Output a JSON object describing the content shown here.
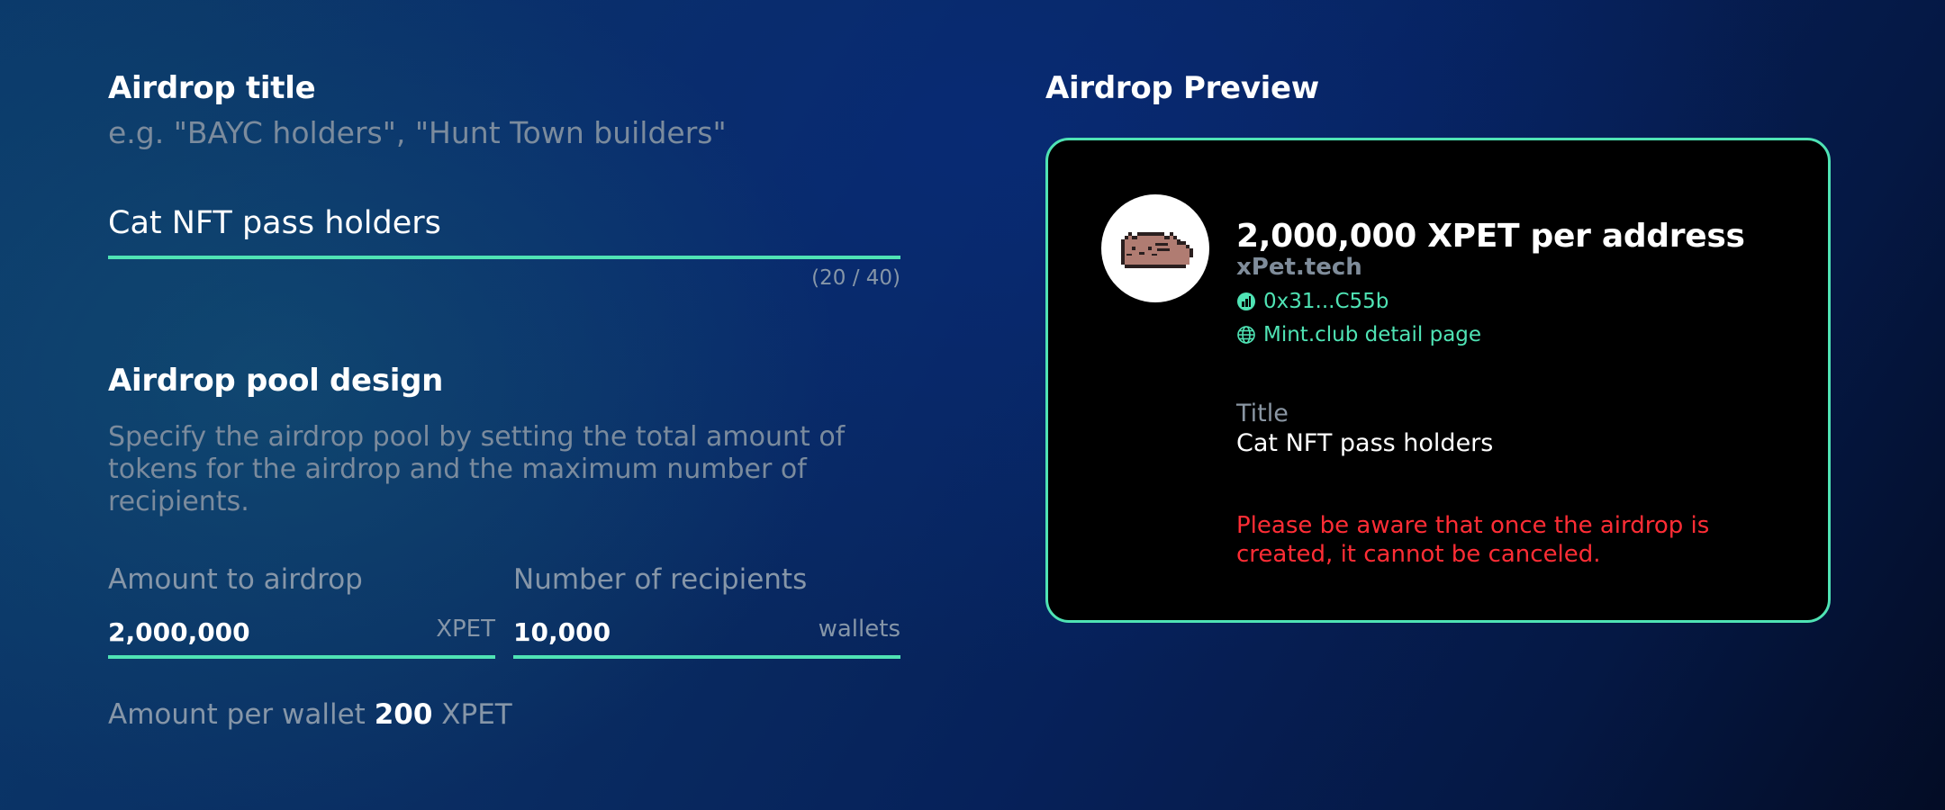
{
  "form": {
    "title_section": {
      "label": "Airdrop title",
      "hint": "e.g. \"BAYC holders\", \"Hunt Town builders\"",
      "value": "Cat NFT pass holders",
      "counter": "(20 / 40)"
    },
    "pool_section": {
      "label": "Airdrop pool design",
      "description": "Specify the airdrop pool by setting the total amount of tokens for the airdrop and the maximum number of recipients.",
      "amount": {
        "label": "Amount to airdrop",
        "value": "2,000,000",
        "unit": "XPET"
      },
      "recipients": {
        "label": "Number of recipients",
        "value": "10,000",
        "unit": "wallets"
      },
      "per_wallet": {
        "prefix": "Amount per wallet",
        "value": "200",
        "unit": "XPET"
      }
    }
  },
  "preview": {
    "label": "Airdrop Preview",
    "heading": "2,000,000 XPET per address",
    "issuer": "xPet.tech",
    "contract_link": "0x31...C55b",
    "contract_icon": "mint-club-logo-icon",
    "detail_link": "Mint.club detail page",
    "detail_icon": "globe-icon",
    "avatar_icon": "pixel-cat-icon",
    "meta_label": "Title",
    "meta_value": "Cat NFT pass holders",
    "warning": "Please be aware that once the airdrop is created, it cannot be canceled."
  },
  "colors": {
    "accent": "#4fe3b4",
    "warning": "#ff2d35",
    "card_bg": "#000000"
  }
}
